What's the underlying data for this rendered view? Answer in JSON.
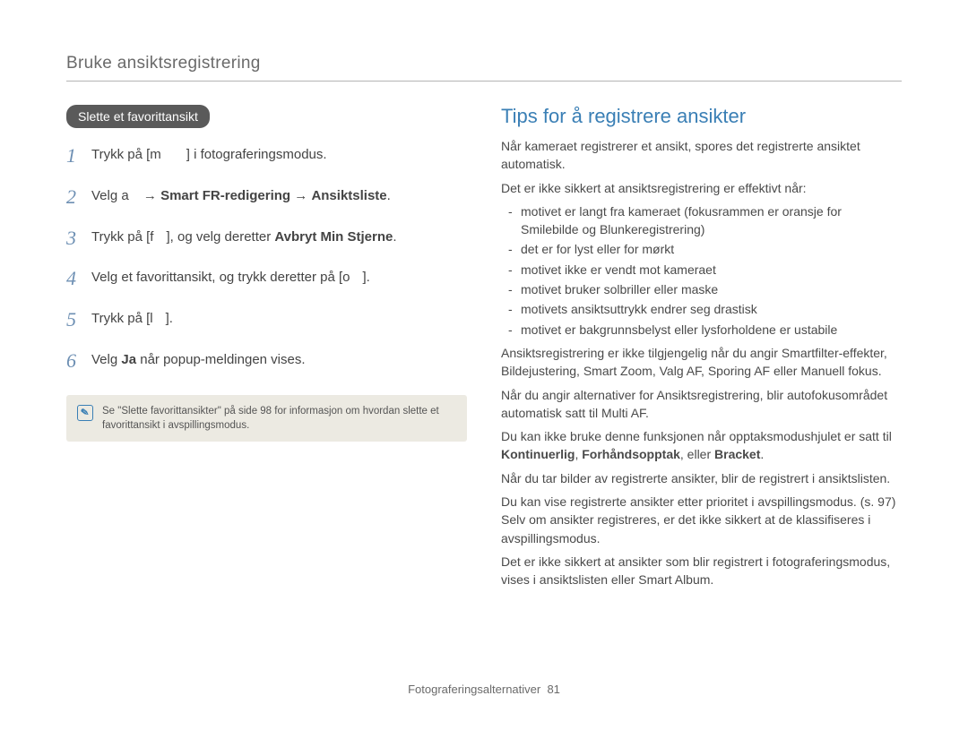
{
  "header": {
    "title": "Bruke ansiktsregistrering"
  },
  "left": {
    "pill": "Slette et favorittansikt",
    "steps": [
      {
        "n": "1",
        "pre": "Trykk på [",
        "key": "m",
        "post": "] i fotograferingsmodus."
      },
      {
        "n": "2",
        "plain1": "Velg ",
        "key": "a",
        "arrow1": " → ",
        "b1": "Smart FR-redigering",
        "arrow2": " → ",
        "b2": "Ansiktsliste",
        "tail": "."
      },
      {
        "n": "3",
        "plain1": "Trykk på [",
        "key": "f",
        "mid": "], og velg deretter ",
        "b1": "Avbryt Min Stjerne",
        "tail": "."
      },
      {
        "n": "4",
        "plain1": "Velg et favorittansikt, og trykk deretter på [",
        "key": "o",
        "tail": "]."
      },
      {
        "n": "5",
        "plain1": "Trykk på [",
        "key": "l",
        "tail": "]."
      },
      {
        "n": "6",
        "plain1": "Velg ",
        "b1": "Ja",
        "tail": " når popup-meldingen vises."
      }
    ],
    "note": "Se \"Slette favorittansikter\" på side 98 for informasjon om hvordan slette et favorittansikt i avspillingsmodus."
  },
  "right": {
    "heading": "Tips for å registrere ansikter",
    "p1": "Når kameraet registrerer et ansikt, spores det registrerte ansiktet automatisk.",
    "p2": "Det er ikke sikkert at ansiktsregistrering er effektivt når:",
    "bullets": [
      "motivet er langt fra kameraet (fokusrammen er oransje for Smilebilde og Blunkeregistrering)",
      "det er for lyst eller for mørkt",
      "motivet ikke er vendt mot kameraet",
      "motivet bruker solbriller eller maske",
      "motivets ansiktsuttrykk endrer seg drastisk",
      "motivet er bakgrunnsbelyst eller lysforholdene er ustabile"
    ],
    "p3": "Ansiktsregistrering er ikke tilgjengelig når du angir Smartfilter-effekter, Bildejustering, Smart Zoom, Valg AF, Sporing AF eller Manuell fokus.",
    "p4": "Når du angir alternativer for Ansiktsregistrering, blir autofokusområdet automatisk satt til Multi AF.",
    "p5a": "Du kan ikke bruke denne funksjonen når opptaksmodushjulet er satt til ",
    "p5b1": "Kontinuerlig",
    "p5c1": ", ",
    "p5b2": "Forhåndsopptak",
    "p5c2": ", eller ",
    "p5b3": "Bracket",
    "p5tail": ".",
    "p6": "Når du tar bilder av registrerte ansikter, blir de registrert i ansiktslisten.",
    "p7": "Du kan vise registrerte ansikter etter prioritet i avspillingsmodus. (s. 97) Selv om ansikter registreres, er det ikke sikkert at de klassifiseres i avspillingsmodus.",
    "p8": "Det er ikke sikkert at ansikter som blir registrert i fotograferingsmodus, vises i ansiktslisten eller Smart Album."
  },
  "footer": {
    "section": "Fotograferingsalternativer",
    "page": "81"
  }
}
